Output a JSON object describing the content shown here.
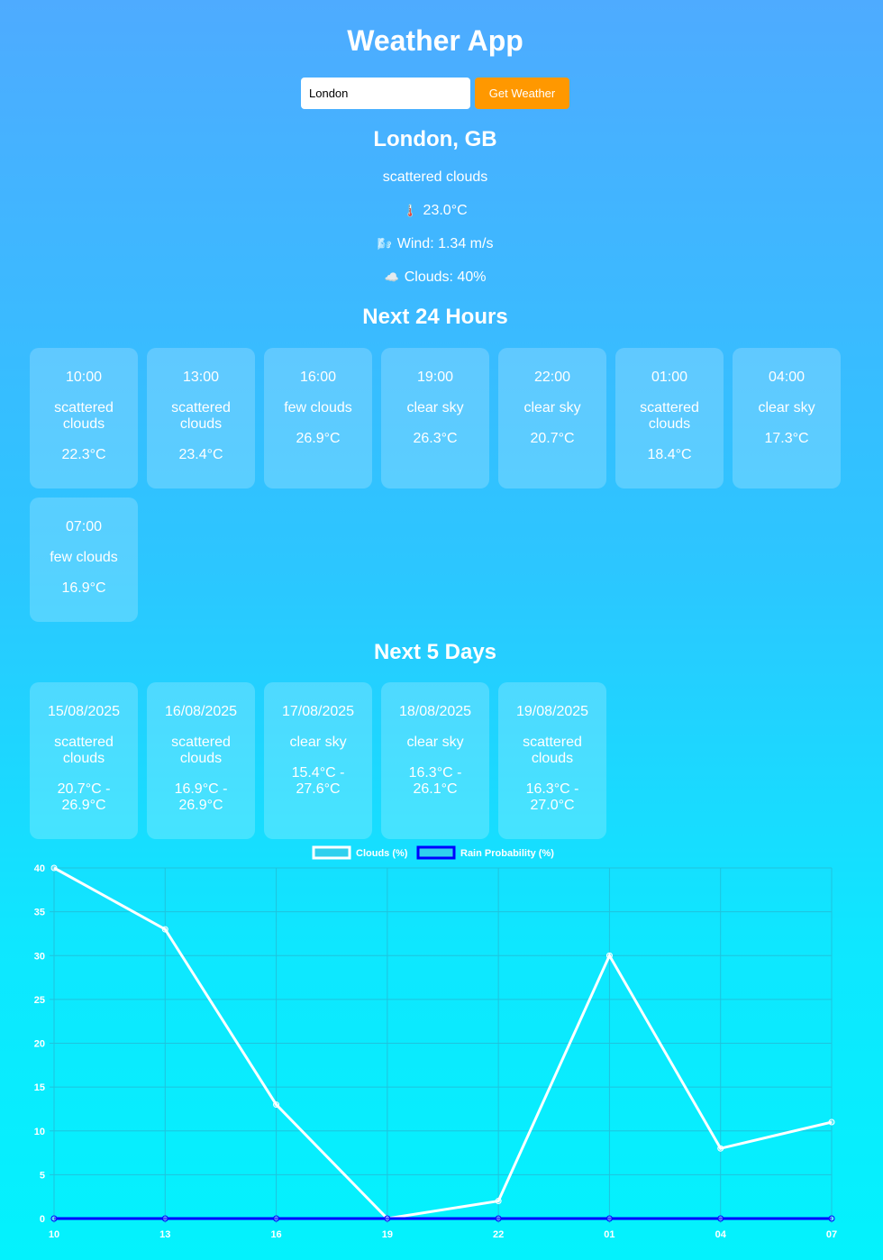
{
  "app": {
    "title": "Weather App"
  },
  "search": {
    "value": "London",
    "button_label": "Get Weather"
  },
  "current": {
    "location": "London, GB",
    "description": "scattered clouds",
    "temperature": "23.0°C",
    "wind": "Wind: 1.34 m/s",
    "clouds": "Clouds: 40%",
    "icons": {
      "temperature": "thermometer-icon",
      "wind": "wind-icon",
      "clouds": "cloud-icon"
    }
  },
  "hourly": {
    "title": "Next 24 Hours",
    "items": [
      {
        "time": "10:00",
        "description": "scattered clouds",
        "temp": "22.3°C"
      },
      {
        "time": "13:00",
        "description": "scattered clouds",
        "temp": "23.4°C"
      },
      {
        "time": "16:00",
        "description": "few clouds",
        "temp": "26.9°C"
      },
      {
        "time": "19:00",
        "description": "clear sky",
        "temp": "26.3°C"
      },
      {
        "time": "22:00",
        "description": "clear sky",
        "temp": "20.7°C"
      },
      {
        "time": "01:00",
        "description": "scattered clouds",
        "temp": "18.4°C"
      },
      {
        "time": "04:00",
        "description": "clear sky",
        "temp": "17.3°C"
      },
      {
        "time": "07:00",
        "description": "few clouds",
        "temp": "16.9°C"
      }
    ]
  },
  "daily": {
    "title": "Next 5 Days",
    "items": [
      {
        "date": "15/08/2025",
        "description": "scattered clouds",
        "range": "20.7°C - 26.9°C"
      },
      {
        "date": "16/08/2025",
        "description": "scattered clouds",
        "range": "16.9°C - 26.9°C"
      },
      {
        "date": "17/08/2025",
        "description": "clear sky",
        "range": "15.4°C - 27.6°C"
      },
      {
        "date": "18/08/2025",
        "description": "clear sky",
        "range": "16.3°C - 26.1°C"
      },
      {
        "date": "19/08/2025",
        "description": "scattered clouds",
        "range": "16.3°C - 27.0°C"
      }
    ]
  },
  "colors": {
    "button": "#ff9800",
    "clouds_line": "#ffffff",
    "rain_line": "#0000ff",
    "grid": "#1fc3dd"
  },
  "chart_data": {
    "type": "line",
    "categories": [
      "10",
      "13",
      "16",
      "19",
      "22",
      "01",
      "04",
      "07"
    ],
    "series": [
      {
        "name": "Clouds (%)",
        "values": [
          40,
          33,
          13,
          0,
          2,
          30,
          8,
          11
        ],
        "color": "#ffffff"
      },
      {
        "name": "Rain Probability (%)",
        "values": [
          0,
          0,
          0,
          0,
          0,
          0,
          0,
          0
        ],
        "color": "#0000ff"
      }
    ],
    "yticks": [
      0,
      5,
      10,
      15,
      20,
      25,
      30,
      35,
      40
    ],
    "ylim": [
      0,
      40
    ],
    "grid": true,
    "legend_position": "top-center",
    "title": "",
    "xlabel": "",
    "ylabel": ""
  }
}
